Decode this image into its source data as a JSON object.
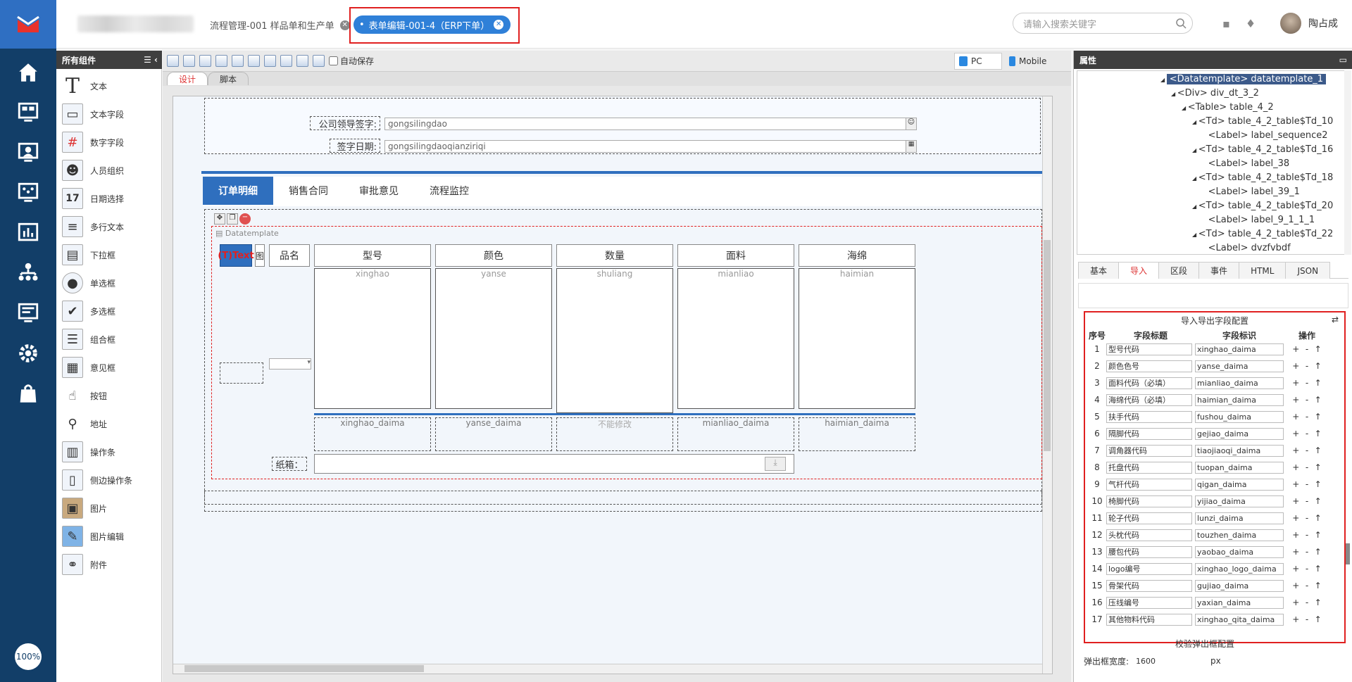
{
  "colors": {
    "nav_bg": "#123e68",
    "accent": "#2f80d8",
    "highlight": "#e02020"
  },
  "leftnav": {
    "icons": [
      "home-icon",
      "dashboard-icon",
      "user-monitor-icon",
      "flow-icon",
      "chart-icon",
      "org-icon",
      "screen-icon",
      "gear-icon",
      "bag-icon"
    ],
    "zoom": "100%"
  },
  "header": {
    "tab1_label": "流程管理-001 样品单和生产单",
    "tab2_label": "表单编辑-001-4（ERP下单）",
    "search_placeholder": "请输入搜索关键字",
    "user_name": "陶占成"
  },
  "components": {
    "title": "所有组件",
    "items": [
      "文本",
      "文本字段",
      "数字字段",
      "人员组织",
      "日期选择",
      "多行文本",
      "下拉框",
      "单选框",
      "多选框",
      "组合框",
      "意见框",
      "按钮",
      "地址",
      "操作条",
      "侧边操作条",
      "图片",
      "图片编辑",
      "附件"
    ]
  },
  "designer": {
    "autosave": "自动保存",
    "pc": "PC",
    "mobile": "Mobile",
    "tab_design": "设计",
    "tab_script": "脚本",
    "sign_label": "公司领导签字:",
    "sign_value": "gongsilingdao",
    "date_label": "签字日期:",
    "date_value": "gongsilingdaoqianziriqi",
    "tabs": [
      "订单明细",
      "销售合同",
      "审批意见",
      "流程监控"
    ],
    "datatemplate": "Datatemplate",
    "ttext": "(T)Text",
    "img_col": "图",
    "name_col": "品名",
    "columns": [
      {
        "title": "型号",
        "val": "xinghao",
        "code": "xinghao_daima"
      },
      {
        "title": "颜色",
        "val": "yanse",
        "code": "yanse_daima"
      },
      {
        "title": "数量",
        "val": "shuliang",
        "code": "不能修改"
      },
      {
        "title": "面料",
        "val": "mianliao",
        "code": "mianliao_daima"
      },
      {
        "title": "海绵",
        "val": "haimian",
        "code": "haimian_daima"
      }
    ],
    "box_label": "纸箱："
  },
  "props": {
    "title": "属性",
    "tree": [
      {
        "text": "<Datatemplate> datatemplate_1",
        "level": 0,
        "selected": true
      },
      {
        "text": "<Div> div_dt_3_2",
        "level": 1
      },
      {
        "text": "<Table> table_4_2",
        "level": 2
      },
      {
        "text": "<Td> table_4_2_table$Td_10",
        "level": 3
      },
      {
        "text": "<Label> label_sequence2",
        "level": 4
      },
      {
        "text": "<Td> table_4_2_table$Td_16",
        "level": 3
      },
      {
        "text": "<Label> label_38",
        "level": 4
      },
      {
        "text": "<Td> table_4_2_table$Td_18",
        "level": 3
      },
      {
        "text": "<Label> label_39_1",
        "level": 4
      },
      {
        "text": "<Td> table_4_2_table$Td_20",
        "level": 3
      },
      {
        "text": "<Label> label_9_1_1_1",
        "level": 4
      },
      {
        "text": "<Td> table_4_2_table$Td_22",
        "level": 3
      },
      {
        "text": "<Label> dvzfvbdf",
        "level": 4
      }
    ],
    "tabs": [
      "基本",
      "导入",
      "区段",
      "事件",
      "HTML",
      "JSON"
    ],
    "config_title": "导入导出字段配置",
    "col_no": "序号",
    "col_title": "字段标题",
    "col_id": "字段标识",
    "col_ops": "操作",
    "rows": [
      [
        "1",
        "型号代码",
        "xinghao_daima"
      ],
      [
        "2",
        "颜色色号",
        "yanse_daima"
      ],
      [
        "3",
        "面料代码（必填）",
        "mianliao_daima"
      ],
      [
        "4",
        "海绵代码（必填）",
        "haimian_daima"
      ],
      [
        "5",
        "扶手代码",
        "fushou_daima"
      ],
      [
        "6",
        "隔脚代码",
        "gejiao_daima"
      ],
      [
        "7",
        "调角器代码",
        "tiaojiaoqi_daima"
      ],
      [
        "8",
        "托盘代码",
        "tuopan_daima"
      ],
      [
        "9",
        "气杆代码",
        "qigan_daima"
      ],
      [
        "10",
        "椅脚代码",
        "yijiao_daima"
      ],
      [
        "11",
        "轮子代码",
        "lunzi_daima"
      ],
      [
        "12",
        "头枕代码",
        "touzhen_daima"
      ],
      [
        "13",
        "腰包代码",
        "yaobao_daima"
      ],
      [
        "14",
        "logo编号",
        "xinghao_logo_daima"
      ],
      [
        "15",
        "骨架代码",
        "gujiao_daima"
      ],
      [
        "16",
        "压线编号",
        "yaxian_daima"
      ],
      [
        "17",
        "其他物料代码",
        "xinghao_qita_daima"
      ]
    ],
    "popup_cfg": "校验弹出框配置",
    "popup_width_label": "弹出框宽度:",
    "popup_width_value": "1600",
    "px": "px"
  }
}
